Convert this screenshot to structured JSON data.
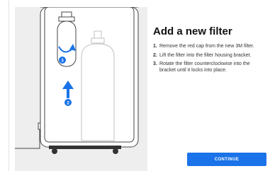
{
  "main": {
    "title": "Add a new filter",
    "steps": [
      {
        "number": "1.",
        "text": "Remove the red cap from the new 3M filter."
      },
      {
        "number": "2.",
        "text": "Lift the filter into the filter housing bracket."
      },
      {
        "number": "3.",
        "text": "Rotate the filter counterclockwise into the bracket until it locks into place."
      }
    ],
    "continue_label": "CONTINUE"
  },
  "illustration": {
    "badge_rotate": "3",
    "badge_lift": "2"
  },
  "colors": {
    "accent": "#1a73e8",
    "panel_background": "#eeeeee"
  },
  "icons": [
    "rotate-arrow-icon",
    "up-arrow-icon",
    "filter-cartridge-icon",
    "co2-tank-icon"
  ]
}
